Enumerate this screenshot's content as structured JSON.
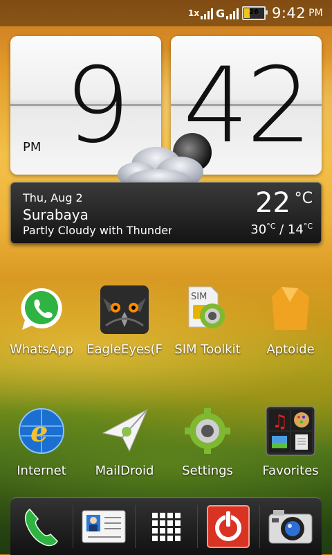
{
  "status_bar": {
    "network_label": "1x",
    "network_type": "G",
    "battery_level": "26",
    "time": "9:42",
    "ampm": "PM"
  },
  "clock_widget": {
    "hour": "9",
    "minute": "42",
    "ampm": "PM"
  },
  "weather_widget": {
    "date": "Thu, Aug 2",
    "city": "Surabaya",
    "condition": "Partly Cloudy with Thunder",
    "temperature": "22",
    "unit": "°C",
    "high": "30",
    "low": "14",
    "range_unit": "°C"
  },
  "apps": [
    {
      "label": "WhatsApp",
      "icon": "whatsapp-icon"
    },
    {
      "label": "EagleEyes(F",
      "icon": "eagleeyes-icon"
    },
    {
      "label": "SIM Toolkit",
      "icon": "sim-toolkit-icon"
    },
    {
      "label": "Aptoide",
      "icon": "aptoide-icon"
    },
    {
      "label": "Internet",
      "icon": "internet-icon"
    },
    {
      "label": "MailDroid",
      "icon": "maildroid-icon"
    },
    {
      "label": "Settings",
      "icon": "settings-icon"
    },
    {
      "label": "Favorites",
      "icon": "favorites-folder-icon"
    }
  ],
  "dock": [
    {
      "name": "phone",
      "icon": "phone-icon"
    },
    {
      "name": "people",
      "icon": "contacts-icon"
    },
    {
      "name": "all apps",
      "icon": "app-drawer-icon"
    },
    {
      "name": "power",
      "icon": "power-icon"
    },
    {
      "name": "camera",
      "icon": "camera-icon"
    }
  ],
  "colors": {
    "accent": "#f0c419",
    "whatsapp": "#2fb342",
    "power": "#d93324"
  }
}
